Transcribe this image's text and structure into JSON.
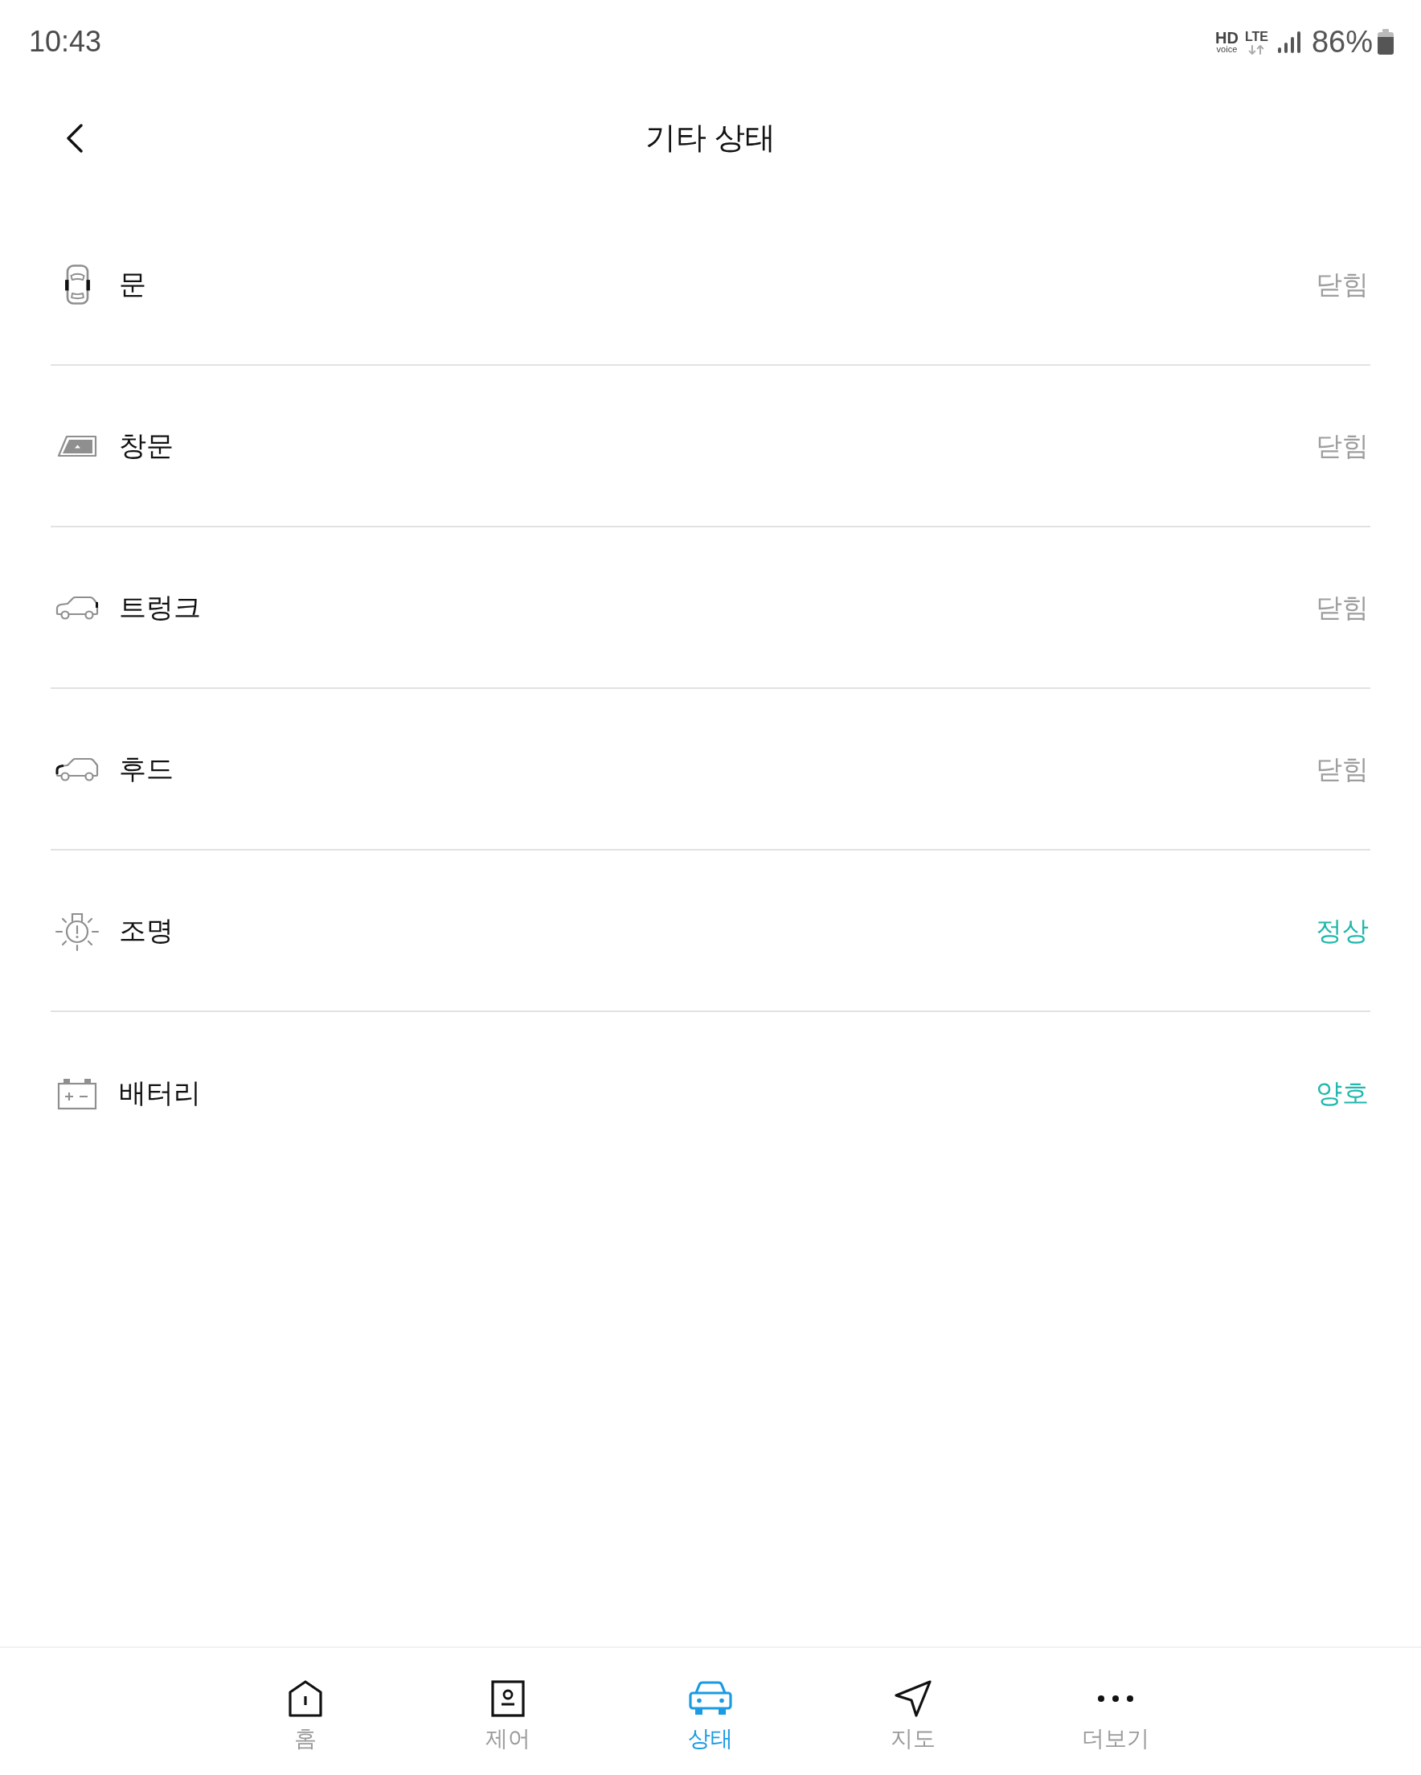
{
  "status_bar": {
    "time": "10:43",
    "hd_label": "HD",
    "voice_label": "voice",
    "network_label": "LTE",
    "battery_percent": "86%"
  },
  "header": {
    "title": "기타 상태"
  },
  "status_items": [
    {
      "kind": "door",
      "label": "문",
      "value": "닫힘",
      "color": "#9e9e9e"
    },
    {
      "kind": "window",
      "label": "창문",
      "value": "닫힘",
      "color": "#9e9e9e"
    },
    {
      "kind": "trunk",
      "label": "트렁크",
      "value": "닫힘",
      "color": "#9e9e9e"
    },
    {
      "kind": "hood",
      "label": "후드",
      "value": "닫힘",
      "color": "#9e9e9e"
    },
    {
      "kind": "light",
      "label": "조명",
      "value": "정상",
      "color": "#20b8ad"
    },
    {
      "kind": "battery",
      "label": "배터리",
      "value": "양호",
      "color": "#20b8ad"
    }
  ],
  "bottom_nav": [
    {
      "kind": "home",
      "label": "홈",
      "selected": false
    },
    {
      "kind": "control",
      "label": "제어",
      "selected": false
    },
    {
      "kind": "status",
      "label": "상태",
      "selected": true
    },
    {
      "kind": "map",
      "label": "지도",
      "selected": false
    },
    {
      "kind": "more",
      "label": "더보기",
      "selected": false
    }
  ]
}
